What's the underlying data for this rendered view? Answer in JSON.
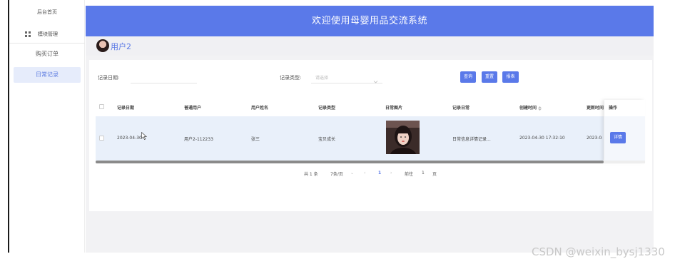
{
  "sidebar": {
    "home": "后台首页",
    "module_mgmt": "模块管理",
    "orders": "购买订单",
    "daily_record": "日常记录"
  },
  "header": {
    "title": "欢迎使用母婴用品交流系统"
  },
  "user": {
    "name": "用户2"
  },
  "search": {
    "date_label": "记录日期:",
    "type_label": "记录类型:",
    "type_placeholder": "请选择",
    "buttons": {
      "search": "查询",
      "reset": "重置",
      "report": "报表"
    }
  },
  "table": {
    "columns": [
      "记录日期",
      "普通用户",
      "用户姓名",
      "记录类型",
      "日常图片",
      "记录日常",
      "创建时间",
      "更新时间",
      "操作"
    ],
    "rows": [
      {
        "date": "2023-04-30",
        "user": "用户2-112233",
        "name": "张三",
        "type": "宝贝成长",
        "content": "日常信息详情记录...",
        "created": "2023-04-30 17:32:10",
        "updated": "2023-04",
        "action": "详情"
      }
    ]
  },
  "pagination": {
    "total": "共 1 条",
    "page_size": "7条/页",
    "current": "1",
    "goto_label": "前往",
    "goto_value": "1",
    "page_unit": "页"
  },
  "watermark": "CSDN @weixin_bysj1330",
  "colors": {
    "accent": "#5a79e9",
    "sidebar_active_bg": "#e6ecfb",
    "row_hover_bg": "#e9f0fa"
  }
}
